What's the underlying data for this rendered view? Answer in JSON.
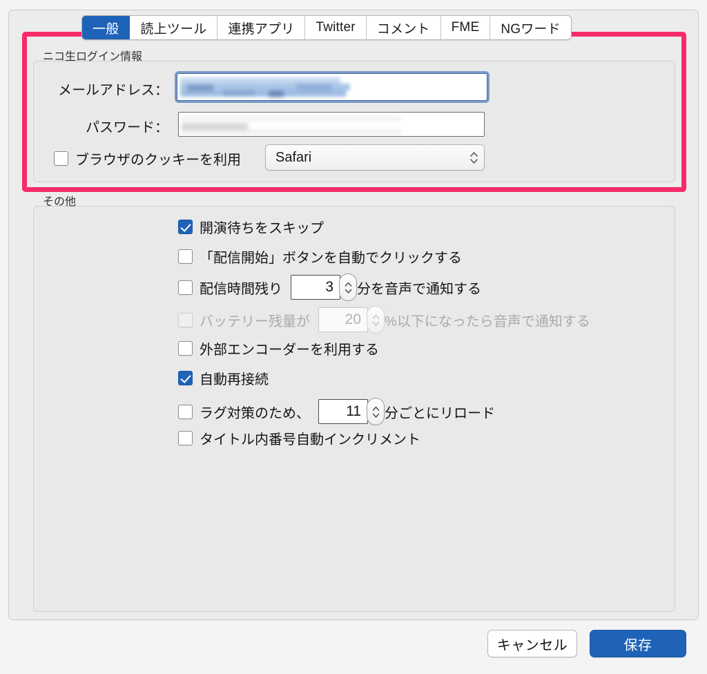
{
  "window": {
    "tabs": [
      {
        "label": "一般",
        "active": true
      },
      {
        "label": "読上ツール",
        "active": false
      },
      {
        "label": "連携アプリ",
        "active": false
      },
      {
        "label": "Twitter",
        "active": false
      },
      {
        "label": "コメント",
        "active": false
      },
      {
        "label": "FME",
        "active": false
      },
      {
        "label": "NGワード",
        "active": false
      }
    ]
  },
  "login_group": {
    "title": "ニコ生ログイン情報",
    "email": {
      "label": "メールアドレス：",
      "value": "",
      "placeholder": "",
      "focused": true,
      "redacted": true
    },
    "password": {
      "label": "パスワード：",
      "value": "",
      "placeholder": "",
      "focused": false,
      "redacted": true
    },
    "use_cookie": {
      "label": "ブラウザのクッキーを利用",
      "checked": false
    },
    "browser_select": {
      "value": "Safari",
      "options": [
        "Safari"
      ]
    }
  },
  "other_group": {
    "title": "その他",
    "options": [
      {
        "id": "skip-wait",
        "checked": true,
        "enabled": true,
        "text_before": "開演待ちをスキップ",
        "stepper": null,
        "text_after": ""
      },
      {
        "id": "auto-click-start",
        "checked": false,
        "enabled": true,
        "text_before": "「配信開始」ボタンを自動でクリックする",
        "stepper": null,
        "text_after": ""
      },
      {
        "id": "remaining-time-notify",
        "checked": false,
        "enabled": true,
        "text_before": "配信時間残り",
        "stepper": {
          "value": "3"
        },
        "text_after": "分を音声で通知する"
      },
      {
        "id": "battery-notify",
        "checked": false,
        "enabled": false,
        "text_before": "バッテリー残量が",
        "stepper": {
          "value": "20"
        },
        "text_after": "%以下になったら音声で通知する"
      },
      {
        "id": "external-encoder",
        "checked": false,
        "enabled": true,
        "text_before": "外部エンコーダーを利用する",
        "stepper": null,
        "text_after": ""
      },
      {
        "id": "auto-reconnect",
        "checked": true,
        "enabled": true,
        "text_before": "自動再接続",
        "stepper": null,
        "text_after": ""
      },
      {
        "id": "lag-reload",
        "checked": false,
        "enabled": true,
        "text_before": "ラグ対策のため、",
        "stepper": {
          "value": "11"
        },
        "text_after": "分ごとにリロード"
      },
      {
        "id": "auto-increment-number",
        "checked": false,
        "enabled": true,
        "text_before": "タイトル内番号自動インクリメント",
        "stepper": null,
        "text_after": ""
      }
    ]
  },
  "footer": {
    "cancel_label": "キャンセル",
    "save_label": "保存"
  },
  "colors": {
    "highlight_pink": "#f72b6a",
    "accent_blue": "#1f63b8",
    "window_bg": "#ececec"
  }
}
